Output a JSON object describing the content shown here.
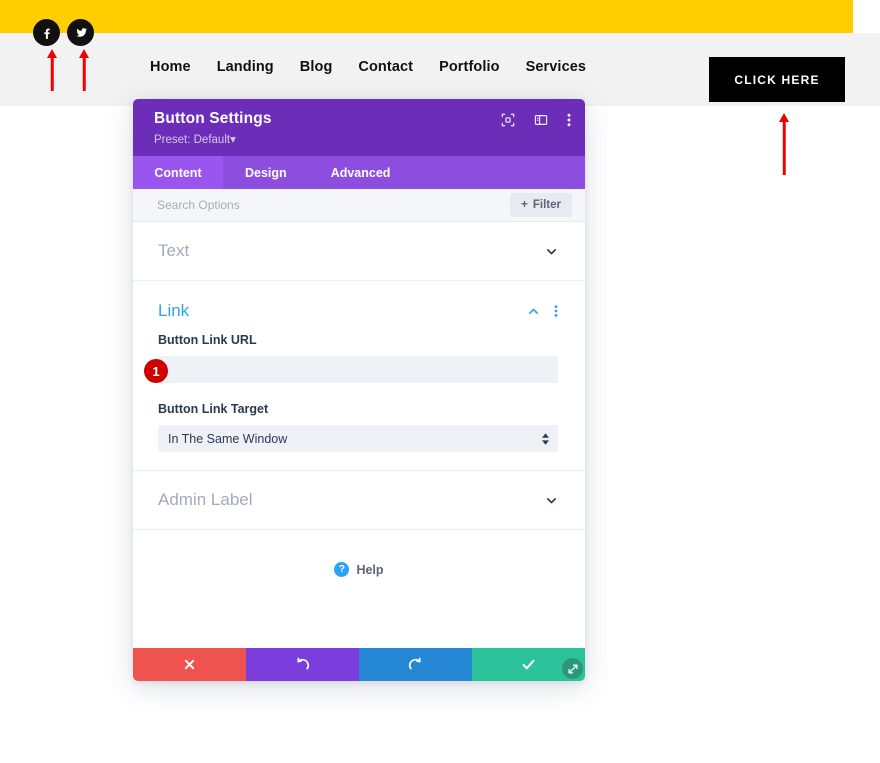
{
  "site": {
    "social": [
      {
        "name": "facebook-icon",
        "label": "Facebook"
      },
      {
        "name": "twitter-icon",
        "label": "Twitter"
      }
    ],
    "nav": [
      {
        "label": "Home"
      },
      {
        "label": "Landing"
      },
      {
        "label": "Blog"
      },
      {
        "label": "Contact"
      },
      {
        "label": "Portfolio"
      },
      {
        "label": "Services"
      }
    ],
    "cta": {
      "label": "CLICK HERE"
    },
    "colors": {
      "topbar": "#ffcd00",
      "header": "#f2f2f2",
      "cta_bg": "#000000",
      "annotation": "#f20000"
    }
  },
  "modal": {
    "title": "Button Settings",
    "preset": "Preset: Default",
    "preset_caret": "▾",
    "head_icons": [
      {
        "name": "fullscreen-icon"
      },
      {
        "name": "layout-columns-icon"
      },
      {
        "name": "more-vertical-icon"
      }
    ],
    "tabs": [
      {
        "label": "Content",
        "active": true
      },
      {
        "label": "Design",
        "active": false
      },
      {
        "label": "Advanced",
        "active": false
      }
    ],
    "search": {
      "placeholder": "Search Options",
      "value": ""
    },
    "filter": {
      "label": "Filter",
      "plus": "+"
    },
    "sections": [
      {
        "title": "Text",
        "open": false
      },
      {
        "title": "Link",
        "open": true
      },
      {
        "title": "Admin Label",
        "open": false
      }
    ],
    "link_section": {
      "url": {
        "label": "Button Link URL",
        "value": "",
        "placeholder": "",
        "badge": "1"
      },
      "target": {
        "label": "Button Link Target",
        "value": "In The Same Window"
      }
    },
    "help": {
      "label": "Help",
      "icon": "?"
    },
    "footer": [
      {
        "name": "cancel-button",
        "glyph": "✕"
      },
      {
        "name": "undo-button",
        "glyph": "↺"
      },
      {
        "name": "redo-button",
        "glyph": "↻"
      },
      {
        "name": "save-button",
        "glyph": "✓"
      }
    ],
    "resize": {
      "name": "resize-handle"
    },
    "colors": {
      "header_bg": "#6c2eb9",
      "tabbar_bg": "#8d4ee0",
      "accent": "#2ea3f2",
      "badge": "#d10000"
    }
  }
}
